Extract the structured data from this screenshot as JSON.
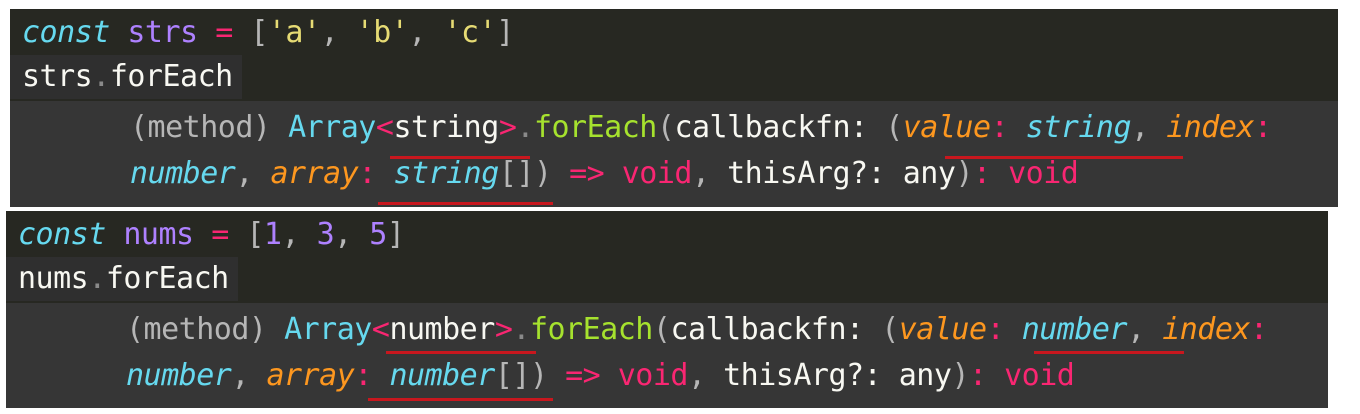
{
  "panels": [
    {
      "line1": {
        "kw": "const",
        "var": "strs",
        "op": "=",
        "open": "[",
        "items": [
          "'a'",
          "'b'",
          "'c'"
        ],
        "close": "]"
      },
      "line2": {
        "obj": "strs",
        "dot": ".",
        "member": "forEach"
      },
      "hover": {
        "method": "(method)",
        "type": "Array",
        "generic_open": "<",
        "generic_type": "string",
        "generic_close": ">",
        "dot": ".",
        "fn": "forEach",
        "callback_label": "callbackfn:",
        "paren_open": "(",
        "p1": "value",
        "p1_type": "string",
        "p2": "index",
        "p2_type": "number",
        "p3": "array",
        "p3_type": "string",
        "arr": "[]",
        "arrow": "=>",
        "ret": "void",
        "this_arg": "thisArg?:",
        "any": "any",
        "ret2": "void"
      }
    },
    {
      "line1": {
        "kw": "const",
        "var": "nums",
        "op": "=",
        "open": "[",
        "items": [
          "1",
          "3",
          "5"
        ],
        "close": "]"
      },
      "line2": {
        "obj": "nums",
        "dot": ".",
        "member": "forEach"
      },
      "hover": {
        "method": "(method)",
        "type": "Array",
        "generic_open": "<",
        "generic_type": "number",
        "generic_close": ">",
        "dot": ".",
        "fn": "forEach",
        "callback_label": "callbackfn:",
        "paren_open": "(",
        "p1": "value",
        "p1_type": "number",
        "p2": "index",
        "p2_type": "number",
        "p3": "array",
        "p3_type": "number",
        "arr": "[]",
        "arrow": "=>",
        "ret": "void",
        "this_arg": "thisArg?:",
        "any": "any",
        "ret2": "void"
      }
    }
  ],
  "colors": {
    "editor_bg": "#272822",
    "hover_bg": "#363636",
    "underline": "#c8171e"
  }
}
